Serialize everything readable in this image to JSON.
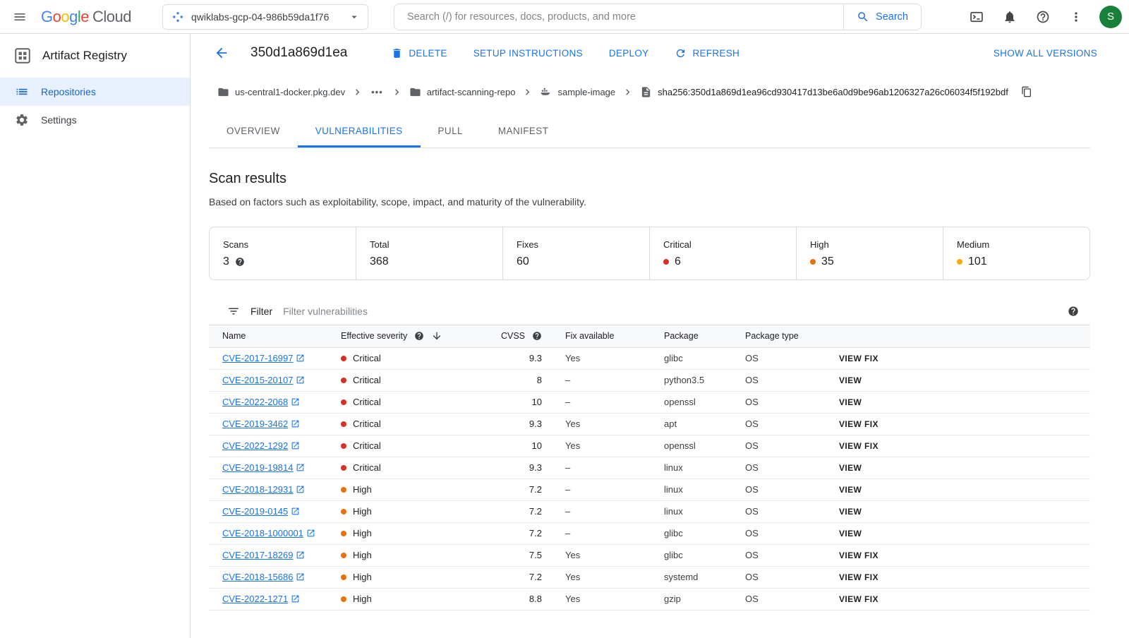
{
  "topbar": {
    "logo_letters": [
      {
        "ch": "G",
        "color": "#4285F4"
      },
      {
        "ch": "o",
        "color": "#EA4335"
      },
      {
        "ch": "o",
        "color": "#FBBC05"
      },
      {
        "ch": "g",
        "color": "#4285F4"
      },
      {
        "ch": "l",
        "color": "#34A853"
      },
      {
        "ch": "e",
        "color": "#EA4335"
      }
    ],
    "logo_cloud": "Cloud",
    "project": "qwiklabs-gcp-04-986b59da1f76",
    "search_placeholder": "Search (/) for resources, docs, products, and more",
    "search_button": "Search",
    "avatar_letter": "S"
  },
  "sidebar": {
    "title": "Artifact Registry",
    "items": [
      {
        "label": "Repositories",
        "selected": true
      },
      {
        "label": "Settings",
        "selected": false
      }
    ]
  },
  "header": {
    "title": "350d1a869d1ea",
    "actions": [
      "DELETE",
      "SETUP INSTRUCTIONS",
      "DEPLOY",
      "REFRESH"
    ],
    "show_all_versions": "SHOW ALL VERSIONS"
  },
  "breadcrumb": {
    "registry": "us-central1-docker.pkg.dev",
    "collapsed": "•••",
    "repo": "artifact-scanning-repo",
    "image": "sample-image",
    "digest": "sha256:350d1a869d1ea96cd930417d13be6a0d9be96ab1206327a26c06034f5f192bdf"
  },
  "tabs": [
    {
      "label": "OVERVIEW",
      "selected": false
    },
    {
      "label": "VULNERABILITIES",
      "selected": true
    },
    {
      "label": "PULL",
      "selected": false
    },
    {
      "label": "MANIFEST",
      "selected": false
    }
  ],
  "scan_results": {
    "title": "Scan results",
    "subtitle": "Based on factors such as exploitability, scope, impact, and maturity of the vulnerability.",
    "stats": [
      {
        "label": "Scans",
        "value": "3"
      },
      {
        "label": "Total",
        "value": "368"
      },
      {
        "label": "Fixes",
        "value": "60"
      },
      {
        "label": "Critical",
        "value": "6",
        "severity": "critical"
      },
      {
        "label": "High",
        "value": "35",
        "severity": "high"
      },
      {
        "label": "Medium",
        "value": "101",
        "severity": "medium"
      }
    ]
  },
  "filter": {
    "label": "Filter",
    "placeholder": "Filter vulnerabilities"
  },
  "table": {
    "columns": {
      "name": "Name",
      "severity": "Effective severity",
      "cvss": "CVSS",
      "fix": "Fix available",
      "package": "Package",
      "package_type": "Package type"
    },
    "rows": [
      {
        "name": "CVE-2017-16997",
        "severity": "Critical",
        "cvss": "9.3",
        "fix_available": "Yes",
        "package": "glibc",
        "package_type": "OS",
        "action": "VIEW FIX"
      },
      {
        "name": "CVE-2015-20107",
        "severity": "Critical",
        "cvss": "8",
        "fix_available": "–",
        "package": "python3.5",
        "package_type": "OS",
        "action": "VIEW"
      },
      {
        "name": "CVE-2022-2068",
        "severity": "Critical",
        "cvss": "10",
        "fix_available": "–",
        "package": "openssl",
        "package_type": "OS",
        "action": "VIEW"
      },
      {
        "name": "CVE-2019-3462",
        "severity": "Critical",
        "cvss": "9.3",
        "fix_available": "Yes",
        "package": "apt",
        "package_type": "OS",
        "action": "VIEW FIX"
      },
      {
        "name": "CVE-2022-1292",
        "severity": "Critical",
        "cvss": "10",
        "fix_available": "Yes",
        "package": "openssl",
        "package_type": "OS",
        "action": "VIEW FIX"
      },
      {
        "name": "CVE-2019-19814",
        "severity": "Critical",
        "cvss": "9.3",
        "fix_available": "–",
        "package": "linux",
        "package_type": "OS",
        "action": "VIEW"
      },
      {
        "name": "CVE-2018-12931",
        "severity": "High",
        "cvss": "7.2",
        "fix_available": "–",
        "package": "linux",
        "package_type": "OS",
        "action": "VIEW"
      },
      {
        "name": "CVE-2019-0145",
        "severity": "High",
        "cvss": "7.2",
        "fix_available": "–",
        "package": "linux",
        "package_type": "OS",
        "action": "VIEW"
      },
      {
        "name": "CVE-2018-1000001",
        "severity": "High",
        "cvss": "7.2",
        "fix_available": "–",
        "package": "glibc",
        "package_type": "OS",
        "action": "VIEW"
      },
      {
        "name": "CVE-2017-18269",
        "severity": "High",
        "cvss": "7.5",
        "fix_available": "Yes",
        "package": "glibc",
        "package_type": "OS",
        "action": "VIEW FIX"
      },
      {
        "name": "CVE-2018-15686",
        "severity": "High",
        "cvss": "7.2",
        "fix_available": "Yes",
        "package": "systemd",
        "package_type": "OS",
        "action": "VIEW FIX"
      },
      {
        "name": "CVE-2022-1271",
        "severity": "High",
        "cvss": "8.8",
        "fix_available": "Yes",
        "package": "gzip",
        "package_type": "OS",
        "action": "VIEW FIX"
      }
    ]
  },
  "colors": {
    "accent": "#1a73e8",
    "critical": "#d93025",
    "high": "#e8710a",
    "medium": "#f9ab00"
  }
}
